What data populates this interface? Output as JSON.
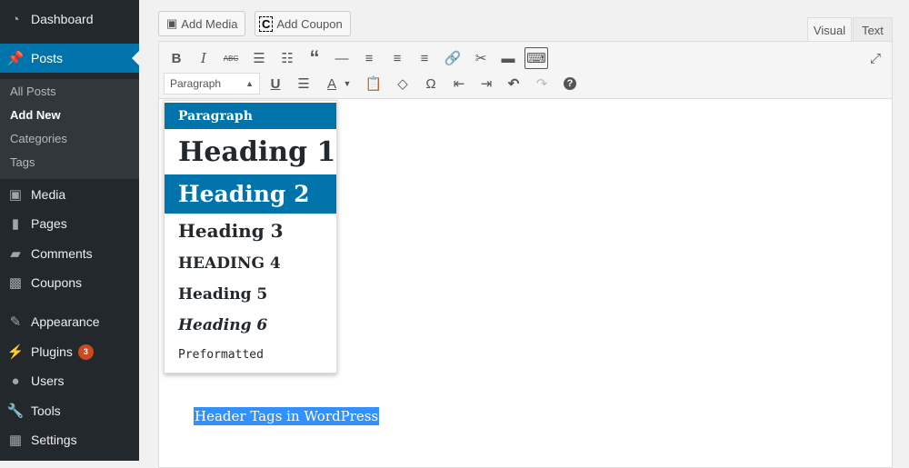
{
  "sidebar": {
    "items": [
      {
        "label": "Dashboard",
        "icon": "dashboard-icon"
      },
      {
        "label": "Posts",
        "icon": "pin-icon"
      },
      {
        "label": "Media",
        "icon": "media-icon"
      },
      {
        "label": "Pages",
        "icon": "pages-icon"
      },
      {
        "label": "Comments",
        "icon": "comment-icon"
      },
      {
        "label": "Coupons",
        "icon": "coupon-icon"
      },
      {
        "label": "Appearance",
        "icon": "brush-icon"
      },
      {
        "label": "Plugins",
        "icon": "plug-icon",
        "badge": "3"
      },
      {
        "label": "Users",
        "icon": "user-icon"
      },
      {
        "label": "Tools",
        "icon": "wrench-icon"
      },
      {
        "label": "Settings",
        "icon": "settings-icon"
      }
    ],
    "submenu": [
      "All Posts",
      "Add New",
      "Categories",
      "Tags"
    ]
  },
  "buttons": {
    "add_media": "Add Media",
    "add_coupon": "Add Coupon"
  },
  "tabs": {
    "visual": "Visual",
    "text": "Text"
  },
  "toolbar": {
    "format_select": "Paragraph"
  },
  "dropdown": [
    "Paragraph",
    "Heading 1",
    "Heading 2",
    "Heading 3",
    "HEADING 4",
    "Heading 5",
    "Heading 6",
    "Preformatted"
  ],
  "content": {
    "selected_text": "Header Tags in WordPress"
  },
  "colors": {
    "accent": "#0073aa",
    "sidebar": "#23282d",
    "badge": "#ca4a1f",
    "selection": "#3390ff"
  }
}
